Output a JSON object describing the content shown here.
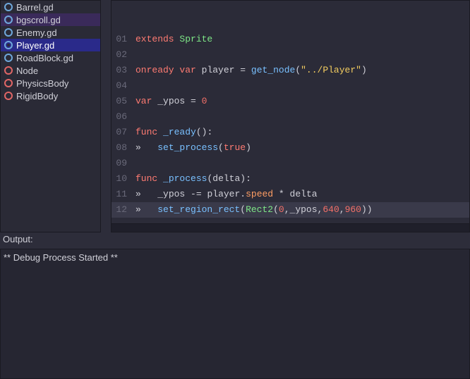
{
  "sidebar": {
    "files": [
      {
        "name": "Barrel.gd",
        "icon": "gear",
        "state": ""
      },
      {
        "name": "bgscroll.gd",
        "icon": "gear",
        "state": "selected"
      },
      {
        "name": "Enemy.gd",
        "icon": "gear",
        "state": ""
      },
      {
        "name": "Player.gd",
        "icon": "gear",
        "state": "running"
      },
      {
        "name": "RoadBlock.gd",
        "icon": "gear",
        "state": ""
      },
      {
        "name": "Node",
        "icon": "circle",
        "state": ""
      },
      {
        "name": "PhysicsBody",
        "icon": "circle",
        "state": ""
      },
      {
        "name": "RigidBody",
        "icon": "circle",
        "state": ""
      }
    ]
  },
  "code": {
    "lines": [
      {
        "n": "01",
        "t": "extends",
        "html": "<span class='kw'>extends</span> <span class='type'>Sprite</span>"
      },
      {
        "n": "02",
        "t": "",
        "html": ""
      },
      {
        "n": "03",
        "t": "onready var player = get_node(\"../Player\")",
        "html": "<span class='kw'>onready</span> <span class='kw'>var</span> <span class='id'>player</span> <span class='op'>=</span> <span class='fn'>get_node</span><span class='paren'>(</span><span class='str'>\"../Player\"</span><span class='paren'>)</span>"
      },
      {
        "n": "04",
        "t": "",
        "html": ""
      },
      {
        "n": "05",
        "t": "var _ypos = 0",
        "html": "<span class='kw'>var</span> <span class='id'>_ypos</span> <span class='op'>=</span> <span class='num'>0</span>"
      },
      {
        "n": "06",
        "t": "",
        "html": ""
      },
      {
        "n": "07",
        "t": "func _ready():",
        "html": "<span class='kw'>func</span> <span class='method'>_ready</span><span class='paren'>()</span><span class='op'>:</span>"
      },
      {
        "n": "08",
        "t": "»   set_process(true)",
        "html": "<span class='op'>»</span>   <span class='fn'>set_process</span><span class='paren'>(</span><span class='kw'>true</span><span class='paren'>)</span>"
      },
      {
        "n": "09",
        "t": "",
        "html": ""
      },
      {
        "n": "10",
        "t": "func _process(delta):",
        "html": "<span class='kw'>func</span> <span class='method'>_process</span><span class='paren'>(</span><span class='id'>delta</span><span class='paren'>)</span><span class='op'>:</span>"
      },
      {
        "n": "11",
        "t": "»   _ypos -= player.speed * delta",
        "html": "<span class='op'>»</span>   <span class='id'>_ypos</span> <span class='op'>-=</span> <span class='id'>player</span><span class='op'>.</span><span class='prop'>speed</span> <span class='op'>*</span> <span class='id'>delta</span>"
      },
      {
        "n": "12",
        "t": "»   set_region_rect(Rect2(0,_ypos,640,960))",
        "html": "<span class='op'>»</span>   <span class='fn'>set_region_rect</span><span class='paren'>(</span><span class='type'>Rect2</span><span class='paren'>(</span><span class='num'>0</span><span class='op'>,</span><span class='id'>_ypos</span><span class='op'>,</span><span class='num'>640</span><span class='op'>,</span><span class='num'>960</span><span class='paren'>))</span>"
      }
    ],
    "current_line": 12
  },
  "output": {
    "header": "Output:",
    "text": "** Debug Process Started **"
  }
}
